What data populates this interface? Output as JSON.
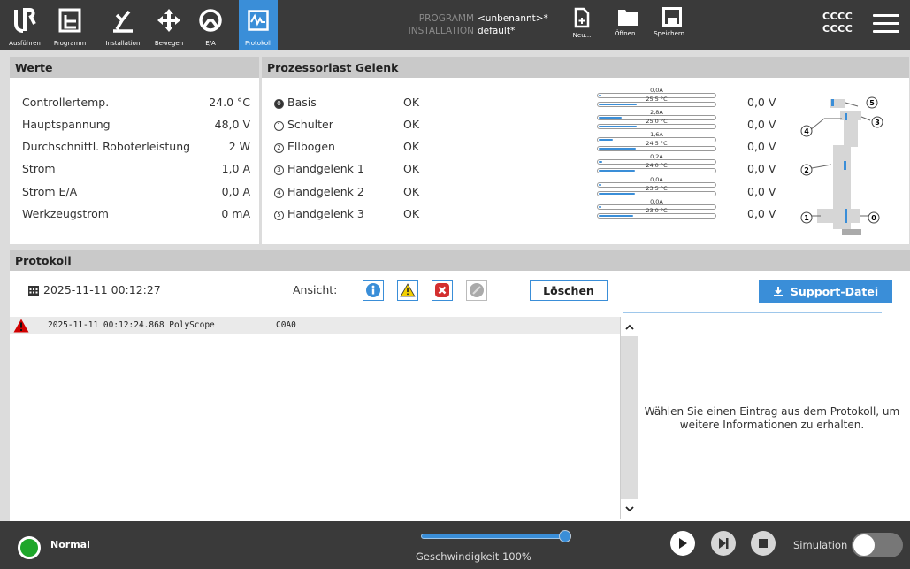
{
  "nav": [
    {
      "label": "Ausführen",
      "icon": "ur-logo-icon"
    },
    {
      "label": "Programm",
      "icon": "program-icon"
    },
    {
      "label": "Installation",
      "icon": "installation-icon"
    },
    {
      "label": "Bewegen",
      "icon": "move-icon"
    },
    {
      "label": "E/A",
      "icon": "io-icon"
    },
    {
      "label": "Protokoll",
      "icon": "log-icon",
      "active": true
    }
  ],
  "program_info": {
    "program_key": "PROGRAMM",
    "program_value": "<unbenannt>*",
    "installation_key": "INSTALLATION",
    "installation_value": "default*"
  },
  "file_buttons": {
    "new": "Neu...",
    "open": "Öffnen...",
    "save": "Speichern..."
  },
  "header_right": {
    "line1": "CCCC",
    "line2": "CCCC"
  },
  "werte": {
    "title": "Werte",
    "rows": [
      {
        "label": "Controllertemp.",
        "value": "24.0 °C"
      },
      {
        "label": "Hauptspannung",
        "value": "48,0 V"
      },
      {
        "label": "Durchschnittl. Roboterleistung",
        "value": "2 W"
      },
      {
        "label": "Strom",
        "value": "1,0 A"
      },
      {
        "label": "Strom E/A",
        "value": "0,0 A"
      },
      {
        "label": "Werkzeugstrom",
        "value": "0 mA"
      }
    ]
  },
  "prozessorlast": {
    "title": "Prozessorlast Gelenk",
    "joints": [
      {
        "num": "0",
        "name": "Basis",
        "status": "OK",
        "current": "0,0A",
        "temp": "25.5 °C",
        "current_fill": 0.02,
        "temp_fill": 0.33,
        "voltage": "0,0 V"
      },
      {
        "num": "1",
        "name": "Schulter",
        "status": "OK",
        "current": "2,8A",
        "temp": "25.0 °C",
        "current_fill": 0.2,
        "temp_fill": 0.33,
        "voltage": "0,0 V"
      },
      {
        "num": "2",
        "name": "Ellbogen",
        "status": "OK",
        "current": "1,6A",
        "temp": "24.5 °C",
        "current_fill": 0.12,
        "temp_fill": 0.32,
        "voltage": "0,0 V"
      },
      {
        "num": "3",
        "name": "Handgelenk 1",
        "status": "OK",
        "current": "0,2A",
        "temp": "24.0 °C",
        "current_fill": 0.03,
        "temp_fill": 0.31,
        "voltage": "0,0 V"
      },
      {
        "num": "4",
        "name": "Handgelenk 2",
        "status": "OK",
        "current": "0,0A",
        "temp": "23.5 °C",
        "current_fill": 0.02,
        "temp_fill": 0.31,
        "voltage": "0,0 V"
      },
      {
        "num": "5",
        "name": "Handgelenk 3",
        "status": "OK",
        "current": "0,0A",
        "temp": "23.0 °C",
        "current_fill": 0.02,
        "temp_fill": 0.3,
        "voltage": "0,0 V"
      }
    ],
    "diagram_labels": [
      "5",
      "3",
      "4",
      "2",
      "1",
      "0"
    ]
  },
  "protokoll": {
    "title": "Protokoll",
    "date": "2025-11-11 00:12:27",
    "ansicht_label": "Ansicht:",
    "loeschen": "Löschen",
    "support": "Support-Datei",
    "entries": [
      {
        "timestamp": "2025-11-11 00:12:24.868",
        "source": "PolyScope",
        "code": "C0A0"
      }
    ],
    "detail_message": "Wählen Sie einen Eintrag aus dem Protokoll, um weitere Informationen zu erhalten."
  },
  "footer": {
    "status": "Normal",
    "speed_label": "Geschwindigkeit 100%",
    "speed_value": 1.0,
    "simulation_label": "Simulation",
    "simulation_on": false
  },
  "colors": {
    "accent": "#3a8ed8",
    "header_bg": "#3a3a3a",
    "status_ok": "#1ea62a",
    "warning": "#d00000"
  }
}
